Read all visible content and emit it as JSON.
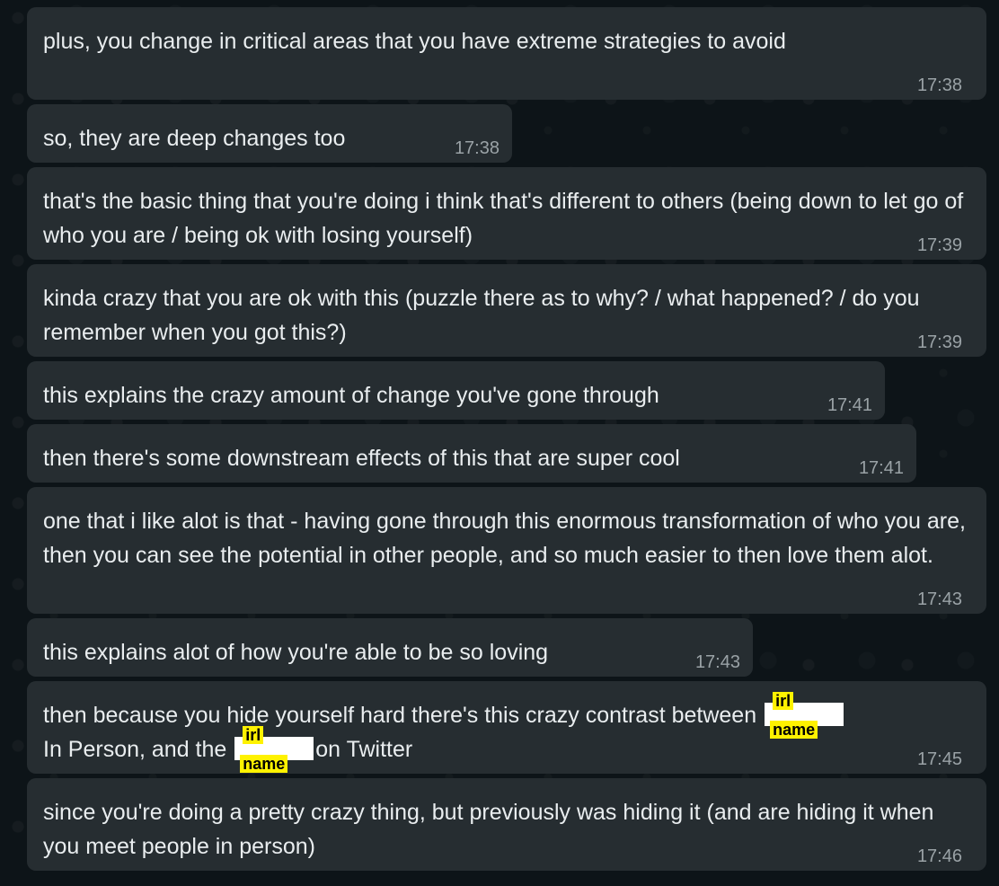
{
  "messages": [
    {
      "text": "plus, you change in critical areas that you have extreme strategies to avoid",
      "time": "17:38"
    },
    {
      "text": "so, they are deep changes too",
      "time": "17:38"
    },
    {
      "text": "that's the basic thing that you're doing i think that's different to others (being down to let go of who you are / being ok with losing yourself)",
      "time": "17:39"
    },
    {
      "text": "kinda crazy that you are ok with this (puzzle there as to why? / what happened? / do you remember when you got this?)",
      "time": "17:39"
    },
    {
      "text": "this explains the crazy amount of change you've gone through",
      "time": "17:41"
    },
    {
      "text": "then there's some downstream effects of this that are super cool",
      "time": "17:41"
    },
    {
      "text": "one that i like alot is that - having gone through this enormous transformation of who you are, then you can see the potential in other people, and so much easier to then love them alot.",
      "time": "17:43"
    },
    {
      "text": "this explains alot of how you're able to be so loving",
      "time": "17:43"
    },
    {
      "part1": "then because you hide yourself hard there's this crazy contrast between",
      "part2": "In Person, and the",
      "part3": "on Twitter",
      "redaction_top": "irl",
      "redaction_bottom": "name",
      "time": "17:45"
    },
    {
      "text": "since you're doing a pretty crazy thing, but previously was hiding it (and are hiding it when you meet people in person)",
      "time": "17:46"
    }
  ]
}
